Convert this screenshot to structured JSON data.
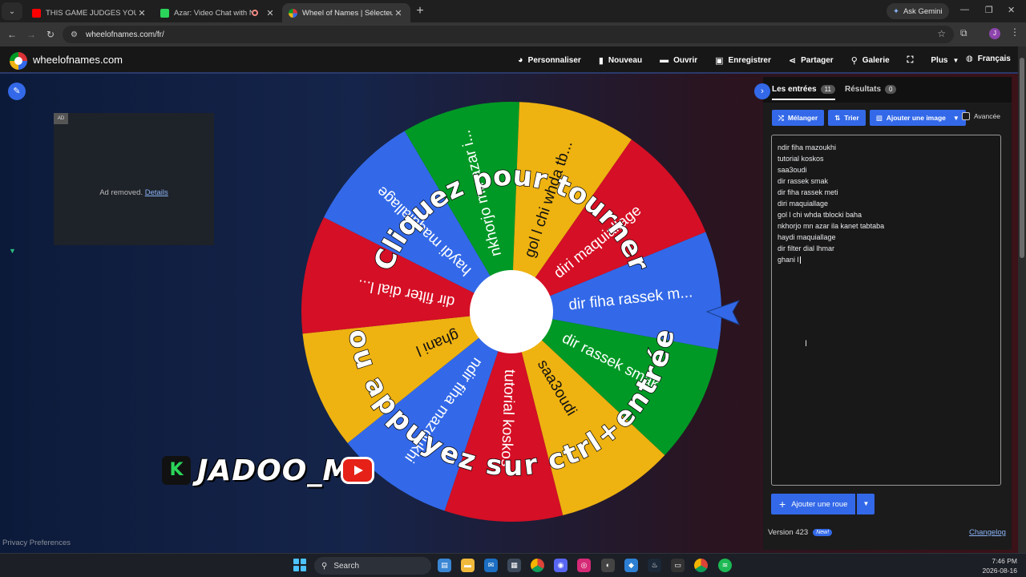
{
  "browser": {
    "tabs": [
      {
        "title": "THIS GAME JUDGES YOUR VOI",
        "favicon_color": "#ff0000",
        "active": false
      },
      {
        "title": "Azar: Video Chat with New",
        "favicon_color": "#2bd45a",
        "active": false
      },
      {
        "title": "Wheel of Names | Sélecteur de",
        "favicon_color": "#3369e8",
        "active": true
      }
    ],
    "ask_gemini": "Ask Gemini",
    "url": "wheelofnames.com/fr/",
    "profile_initial": "J"
  },
  "site": {
    "brand": "wheelofnames.com",
    "menu": [
      {
        "label": "Personnaliser",
        "icon": "palette-icon"
      },
      {
        "label": "Nouveau",
        "icon": "file-icon"
      },
      {
        "label": "Ouvrir",
        "icon": "folder-icon"
      },
      {
        "label": "Enregistrer",
        "icon": "save-icon"
      },
      {
        "label": "Partager",
        "icon": "share-icon"
      },
      {
        "label": "Galerie",
        "icon": "search-icon"
      },
      {
        "label": "",
        "icon": "fullscreen-icon"
      },
      {
        "label": "Plus",
        "icon": "chevron-down-icon"
      }
    ],
    "language": "Français",
    "ad": {
      "tag": "AD",
      "text": "Ad removed.",
      "link": "Details"
    },
    "privacy": "Privacy Preferences"
  },
  "wheel": {
    "slices": [
      "dir fiha rassek m...",
      "dir rassek smak",
      "saa3oudi",
      "tutorial koskos",
      "ndir fiha mazoukhi",
      "ghani l",
      "dir filter dial l...",
      "haydi maquiallage",
      "nkhorjo mn azar i...",
      "gol l chi whda tb...",
      "diri maquiallage"
    ],
    "colors": [
      "#3369e8",
      "#009925",
      "#eeb211",
      "#d50f25",
      "#3369e8",
      "#eeb211",
      "#d50f25",
      "#3369e8",
      "#009925",
      "#eeb211",
      "#d50f25"
    ],
    "prompt_top": "Cliquez pour tourner",
    "prompt_bottom": "ou appuyez sur ctrl+entrée"
  },
  "overlay": {
    "name": "JADOO_MA",
    "badge": "K"
  },
  "panel": {
    "tabs": [
      {
        "label": "Les entrées",
        "count": "11"
      },
      {
        "label": "Résultats",
        "count": "0"
      }
    ],
    "buttons": {
      "shuffle": "Mélanger",
      "sort": "Trier",
      "add_image": "Ajouter une image"
    },
    "advanced": "Avancée",
    "entries": [
      "ndir fiha mazoukhi",
      "tutorial koskos",
      "saa3oudi",
      "dir rassek smak",
      "dir fiha rassek meti",
      "diri maquiallage",
      "gol l chi whda tblocki baha",
      "nkhorjo mn azar ila kanet tabtaba",
      "haydi maquiallage",
      "dir filter dial lhmar",
      "ghani l"
    ],
    "add_wheel": "Ajouter une roue",
    "version": "Version 423",
    "new_badge": "New!",
    "changelog": "Changelog"
  },
  "taskbar": {
    "search": "Search",
    "time": "7:46 PM",
    "date": "2026-08-16"
  }
}
